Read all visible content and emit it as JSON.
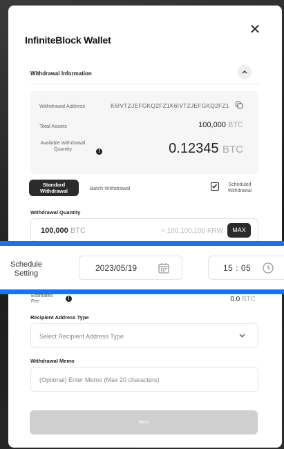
{
  "modal": {
    "title": "InfiniteBlock Wallet",
    "close_icon": "close-icon"
  },
  "withdrawal_info": {
    "section_title": "Withdrawal Information",
    "address_label": "Withdrawal Address",
    "address_value": "K6IVTZJEFGKQ2FZ1K6IVTZJEFGKQ2FZ1",
    "total_assets_label": "Total Assets",
    "total_assets_value": "100,000",
    "total_assets_unit": "BTC",
    "available_label": "Available Withdrawal Quantity",
    "available_value": "0.12345",
    "available_unit": "BTC"
  },
  "tabs": {
    "standard": "Standard Withdrawal",
    "batch": "Batch Withdrawal",
    "scheduled": "Scheduled Withdrawal",
    "scheduled_checked": true
  },
  "quantity": {
    "label": "Withdrawal Quantity",
    "value": "100,000",
    "unit": "BTC",
    "converted": "≈ 100,100,100 KRW",
    "max_label": "MAX"
  },
  "schedule": {
    "label": "Schedule Setting",
    "date": "2023/05/19",
    "time": "15 : 05"
  },
  "fee": {
    "label": "Estimated Fee",
    "value": "0.0",
    "unit": "BTC"
  },
  "recipient": {
    "label": "Recipient Address Type",
    "placeholder": "Select Recipient Address Type"
  },
  "memo": {
    "label": "Withdrawal Memo",
    "placeholder": "(Optional) Enter Memo (Max 20 characters)"
  },
  "next_label": "Next",
  "colors": {
    "accent_blue": "#1a73e8",
    "dark_button": "#2b2b2b",
    "disabled_button": "#cfcfcf"
  }
}
